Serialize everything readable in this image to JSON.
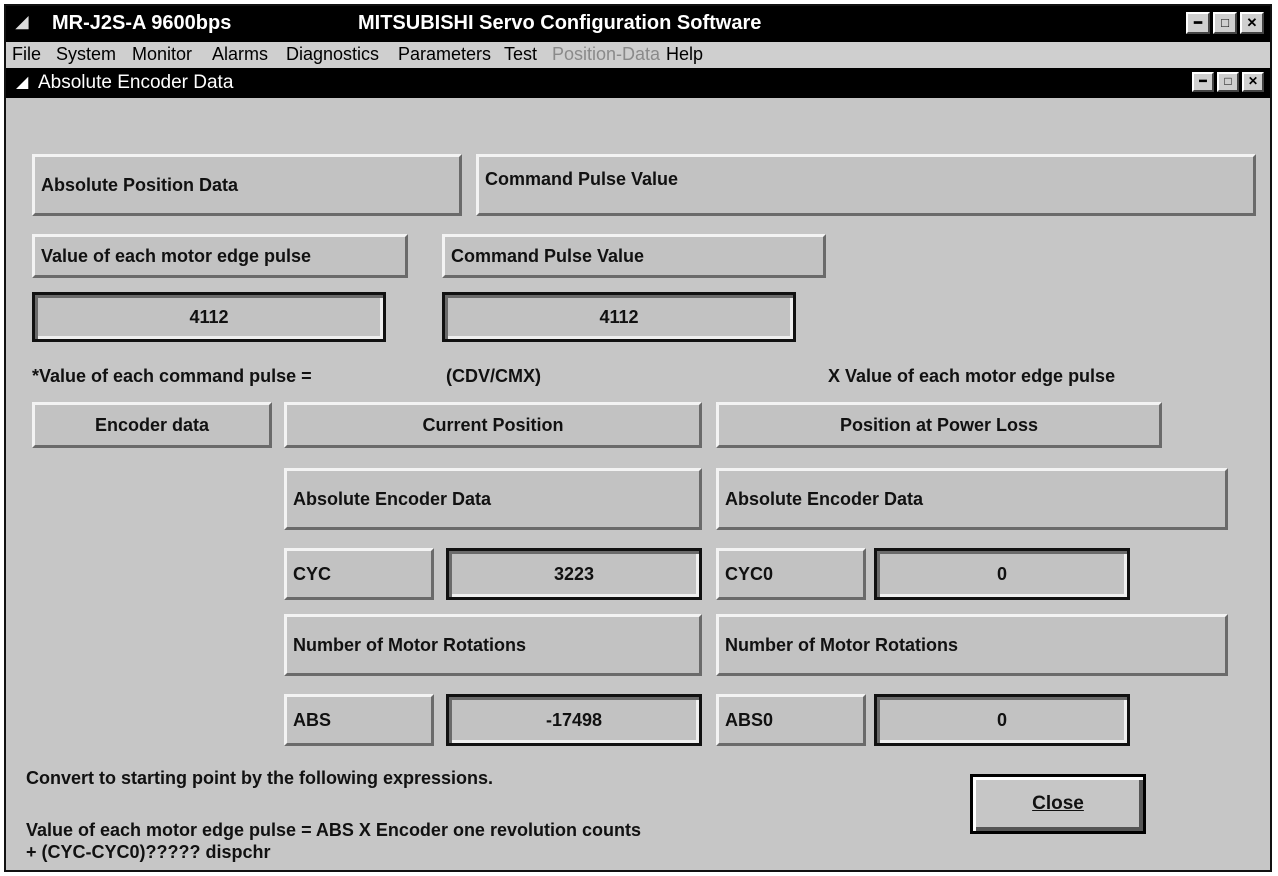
{
  "app": {
    "title_left": "MR-J2S-A 9600bps",
    "title_main": "MITSUBISHI Servo Configuration Software"
  },
  "menu": [
    "File",
    "System",
    "Monitor",
    "Alarms",
    "Diagnostics",
    "Parameters",
    "Test",
    "Position-Data",
    "Help"
  ],
  "dialog": {
    "title": "Absolute Encoder Data"
  },
  "abs_position_label": "Absolute Position Data",
  "cmd_pulse_header": "Command Pulse Value",
  "motor_edge_label": "Value of each motor edge pulse",
  "cmd_pulse_label": "Command Pulse Value",
  "motor_edge_value": "4112",
  "cmd_pulse_value": "4112",
  "formula": {
    "part1": "*Value of each command pulse =",
    "part2": "(CDV/CMX)",
    "part3": "X  Value of each motor edge pulse"
  },
  "encoder_data_label": "Encoder data",
  "current": {
    "header": "Current Position",
    "sub": "Absolute Encoder Data",
    "cyc_label": "CYC",
    "cyc_value": "3223",
    "rot_header": "Number of Motor Rotations",
    "abs_label": "ABS",
    "abs_value": "-17498"
  },
  "power_loss": {
    "header": "Position at Power Loss",
    "sub": "Absolute Encoder Data",
    "cyc_label": "CYC0",
    "cyc_value": "0",
    "rot_header": "Number of Motor Rotations",
    "abs_label": "ABS0",
    "abs_value": "0"
  },
  "footer": {
    "line1": "Convert to starting point by the following expressions.",
    "line2": "Value of each motor edge pulse =  ABS X Encoder one revolution counts",
    "line3": "+ (CYC-CYC0)????? dispchr"
  },
  "close_label": "Close"
}
